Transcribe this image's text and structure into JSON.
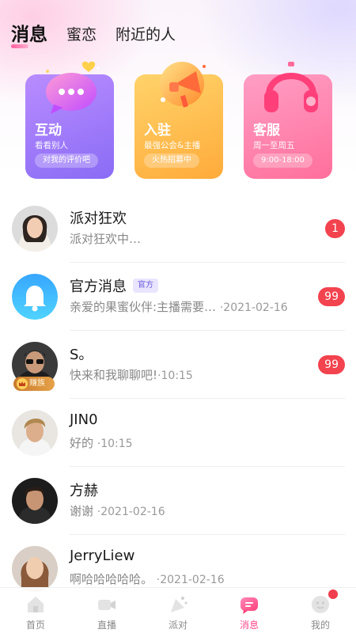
{
  "tabs": [
    {
      "label": "消息",
      "active": true
    },
    {
      "label": "蜜恋",
      "active": false
    },
    {
      "label": "附近的人",
      "active": false
    }
  ],
  "cards": [
    {
      "title": "互动",
      "subtitle": "看看别人",
      "pill": "对我的评价吧",
      "icon": "chat-bubble-icon"
    },
    {
      "title": "入驻",
      "subtitle": "最强公会&主播",
      "pill": "火热招募中",
      "icon": "megaphone-icon"
    },
    {
      "title": "客服",
      "subtitle": "周一至周五",
      "pill": "9:00-18:00",
      "icon": "headphones-icon"
    }
  ],
  "conversations": [
    {
      "name": "派对狂欢",
      "preview": "派对狂欢中…",
      "time": "",
      "badge": "1"
    },
    {
      "name": "官方消息",
      "tag": "官方",
      "preview": "亲爱的果蜜伙伴:主播需要…",
      "time": "·2021-02-16",
      "badge": "99"
    },
    {
      "name": "S。",
      "preview": "快来和我聊聊吧!",
      "time": "·10:15",
      "badge": "99",
      "avatar_badge": "赚族"
    },
    {
      "name": "JIN0",
      "preview": "好的",
      "time": "·10:15",
      "badge": ""
    },
    {
      "name": "方赫",
      "preview": "谢谢",
      "time": "·2021-02-16",
      "badge": ""
    },
    {
      "name": "JerryLiew",
      "preview": "啊哈哈哈哈哈。",
      "time": "·2021-02-16",
      "badge": ""
    }
  ],
  "bottom_nav": [
    {
      "label": "首页",
      "icon": "home-icon",
      "active": false
    },
    {
      "label": "直播",
      "icon": "video-camera-icon",
      "active": false
    },
    {
      "label": "派对",
      "icon": "party-icon",
      "active": false
    },
    {
      "label": "消息",
      "icon": "message-icon",
      "active": true
    },
    {
      "label": "我的",
      "icon": "profile-icon",
      "active": false,
      "dot": true
    }
  ],
  "colors": {
    "accent": "#ff4b8b",
    "badge_red": "#f2434e",
    "card_purple": "#8a6cf5",
    "card_orange": "#ffab3a",
    "card_pink": "#ff6f9c"
  }
}
